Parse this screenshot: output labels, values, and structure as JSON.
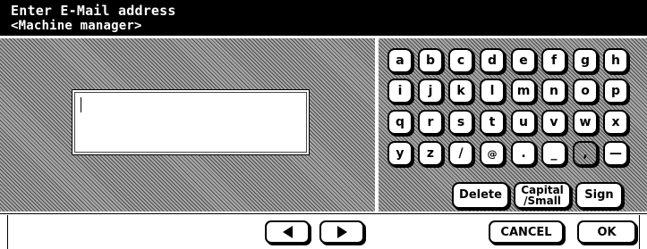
{
  "title": {
    "line1": "Enter E-Mail address",
    "line2": "<Machine manager>"
  },
  "input": {
    "value": ""
  },
  "keyboard": {
    "rows": [
      [
        "a",
        "b",
        "c",
        "d",
        "e",
        "f",
        "g",
        "h"
      ],
      [
        "i",
        "j",
        "k",
        "l",
        "m",
        "n",
        "o",
        "p"
      ],
      [
        "q",
        "r",
        "s",
        "t",
        "u",
        "v",
        "w",
        "x"
      ],
      [
        "y",
        "z",
        "/",
        "@",
        ".",
        "_",
        ",",
        "—"
      ]
    ],
    "delete_label": "Delete",
    "capital_label": "Capital\n/Small",
    "sign_label": "Sign"
  },
  "nav": {
    "prev_icon": "arrow-left-icon",
    "next_icon": "arrow-right-icon"
  },
  "footer": {
    "cancel_label": "CANCEL",
    "ok_label": "OK"
  }
}
